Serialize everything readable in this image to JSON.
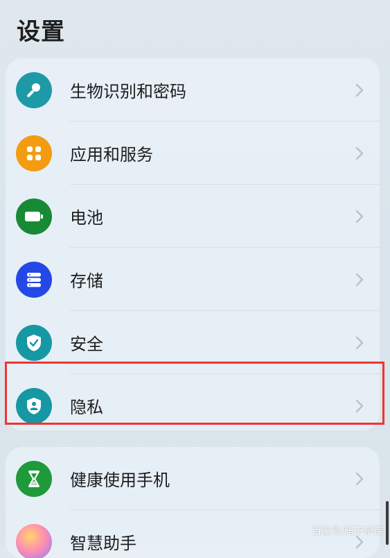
{
  "header": {
    "title": "设置"
  },
  "settings_group_1": [
    {
      "label": "生物识别和密码",
      "icon": "key-icon",
      "icon_color": "#1e9aa7"
    },
    {
      "label": "应用和服务",
      "icon": "apps-icon",
      "icon_color": "#f39c12"
    },
    {
      "label": "电池",
      "icon": "battery-icon",
      "icon_color": "#168a35"
    },
    {
      "label": "存储",
      "icon": "storage-icon",
      "icon_color": "#2448e6"
    },
    {
      "label": "安全",
      "icon": "shield-check-icon",
      "icon_color": "#1698a4"
    },
    {
      "label": "隐私",
      "icon": "privacy-shield-icon",
      "icon_color": "#1698a4"
    }
  ],
  "settings_group_2": [
    {
      "label": "健康使用手机",
      "icon": "hourglass-icon",
      "icon_color": "#1f9a3a"
    },
    {
      "label": "智慧助手",
      "icon": "smart-assistant-icon",
      "icon_color": "#e45aa6"
    }
  ],
  "watermark": "百家号/码不亭蹄",
  "highlight_color": "#ef3434"
}
